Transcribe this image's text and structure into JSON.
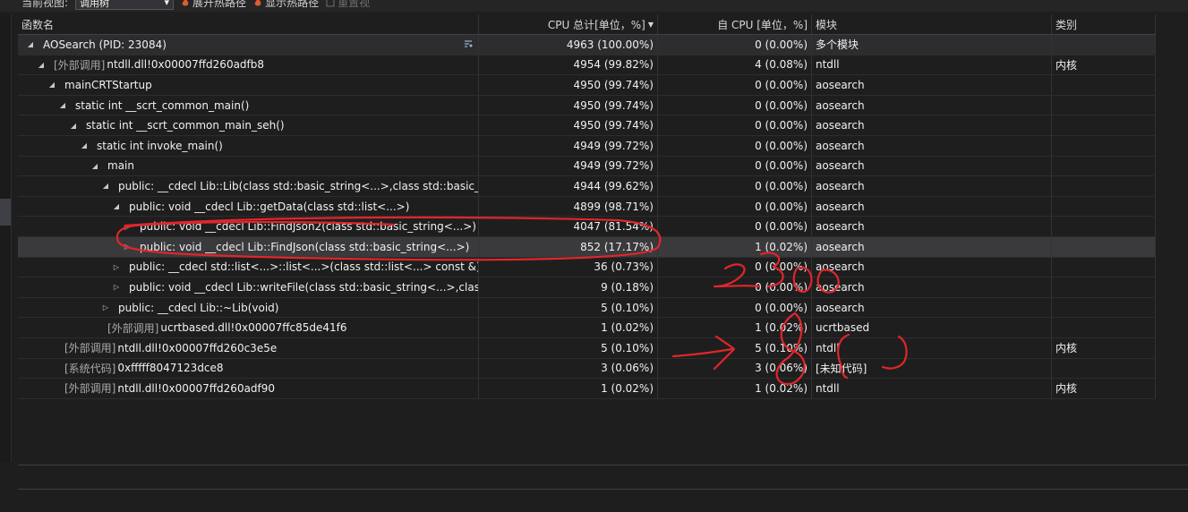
{
  "toolbar": {
    "view_label": "当前视图:",
    "view_value": "调用树",
    "expand_hot_path": "展开热路径",
    "show_hot_path": "显示热路径",
    "reset_view": "重置视"
  },
  "columns": {
    "name": "函数名",
    "total_cpu": "CPU 总计[单位，%]",
    "self_cpu": "自 CPU [单位，%]",
    "module": "模块",
    "category": "类别"
  },
  "rows": [
    {
      "indent": 0,
      "expander": "expanded",
      "prefix": "",
      "name": "AOSearch (PID: 23084)",
      "total": "4963 (100.00%)",
      "self": "0 (0.00%)",
      "module": "多个模块",
      "category": ""
    },
    {
      "indent": 1,
      "expander": "expanded",
      "prefix": "[外部调用]",
      "name": "ntdll.dll!0x00007ffd260adfb8",
      "total": "4954 (99.82%)",
      "self": "4 (0.08%)",
      "module": "ntdll",
      "category": "内核"
    },
    {
      "indent": 2,
      "expander": "expanded",
      "prefix": "",
      "name": "mainCRTStartup",
      "total": "4950 (99.74%)",
      "self": "0 (0.00%)",
      "module": "aosearch",
      "category": ""
    },
    {
      "indent": 3,
      "expander": "expanded",
      "prefix": "",
      "name": "static int __scrt_common_main()",
      "total": "4950 (99.74%)",
      "self": "0 (0.00%)",
      "module": "aosearch",
      "category": ""
    },
    {
      "indent": 4,
      "expander": "expanded",
      "prefix": "",
      "name": "static int __scrt_common_main_seh()",
      "total": "4950 (99.74%)",
      "self": "0 (0.00%)",
      "module": "aosearch",
      "category": ""
    },
    {
      "indent": 5,
      "expander": "expanded",
      "prefix": "",
      "name": "static int invoke_main()",
      "total": "4949 (99.72%)",
      "self": "0 (0.00%)",
      "module": "aosearch",
      "category": ""
    },
    {
      "indent": 6,
      "expander": "expanded",
      "prefix": "",
      "name": "main",
      "total": "4949 (99.72%)",
      "self": "0 (0.00%)",
      "module": "aosearch",
      "category": ""
    },
    {
      "indent": 7,
      "expander": "expanded",
      "prefix": "",
      "name": "public: __cdecl Lib::Lib(class std::basic_string<...>,class std::basic_str...",
      "total": "4944 (99.62%)",
      "self": "0 (0.00%)",
      "module": "aosearch",
      "category": ""
    },
    {
      "indent": 8,
      "expander": "expanded",
      "prefix": "",
      "name": "public: void __cdecl Lib::getData(class std::list<...>)",
      "total": "4899 (98.71%)",
      "self": "0 (0.00%)",
      "module": "aosearch",
      "category": ""
    },
    {
      "indent": 9,
      "expander": "collapsed",
      "prefix": "",
      "name": "public: void __cdecl Lib::FindJson2(class std::basic_string<...>)",
      "total": "4047 (81.54%)",
      "self": "0 (0.00%)",
      "module": "aosearch",
      "category": ""
    },
    {
      "indent": 9,
      "expander": "collapsed",
      "prefix": "",
      "name": "public: void __cdecl Lib::FindJson(class std::basic_string<...>)",
      "total": "852 (17.17%)",
      "self": "1 (0.02%)",
      "module": "aosearch",
      "category": "",
      "selected": true
    },
    {
      "indent": 8,
      "expander": "collapsed",
      "prefix": "",
      "name": "public: __cdecl std::list<...>::list<...>(class std::list<...> const &)",
      "total": "36 (0.73%)",
      "self": "0 (0.00%)",
      "module": "aosearch",
      "category": ""
    },
    {
      "indent": 8,
      "expander": "collapsed",
      "prefix": "",
      "name": "public: void __cdecl Lib::writeFile(class std::basic_string<...>,class ...",
      "total": "9 (0.18%)",
      "self": "0 (0.00%)",
      "module": "aosearch",
      "category": ""
    },
    {
      "indent": 7,
      "expander": "collapsed",
      "prefix": "",
      "name": "public: __cdecl Lib::~Lib(void)",
      "total": "5 (0.10%)",
      "self": "0 (0.00%)",
      "module": "aosearch",
      "category": ""
    },
    {
      "indent": 6,
      "expander": "none",
      "prefix": "[外部调用]",
      "name": "ucrtbased.dll!0x00007ffc85de41f6",
      "total": "1 (0.02%)",
      "self": "1 (0.02%)",
      "module": "ucrtbased",
      "category": ""
    },
    {
      "indent": 2,
      "expander": "none",
      "prefix": "[外部调用]",
      "name": "ntdll.dll!0x00007ffd260c3e5e",
      "total": "5 (0.10%)",
      "self": "5 (0.10%)",
      "module": "ntdll",
      "category": "内核"
    },
    {
      "indent": 2,
      "expander": "none",
      "prefix": "[系统代码]",
      "name": "0xfffff8047123dce8",
      "total": "3 (0.06%)",
      "self": "3 (0.06%)",
      "module": "[未知代码]",
      "category": ""
    },
    {
      "indent": 2,
      "expander": "none",
      "prefix": "[外部调用]",
      "name": "ntdll.dll!0x00007ffd260adf90",
      "total": "1 (0.02%)",
      "self": "1 (0.02%)",
      "module": "ntdll",
      "category": "内核"
    }
  ],
  "annotation_color": "#e0262b"
}
